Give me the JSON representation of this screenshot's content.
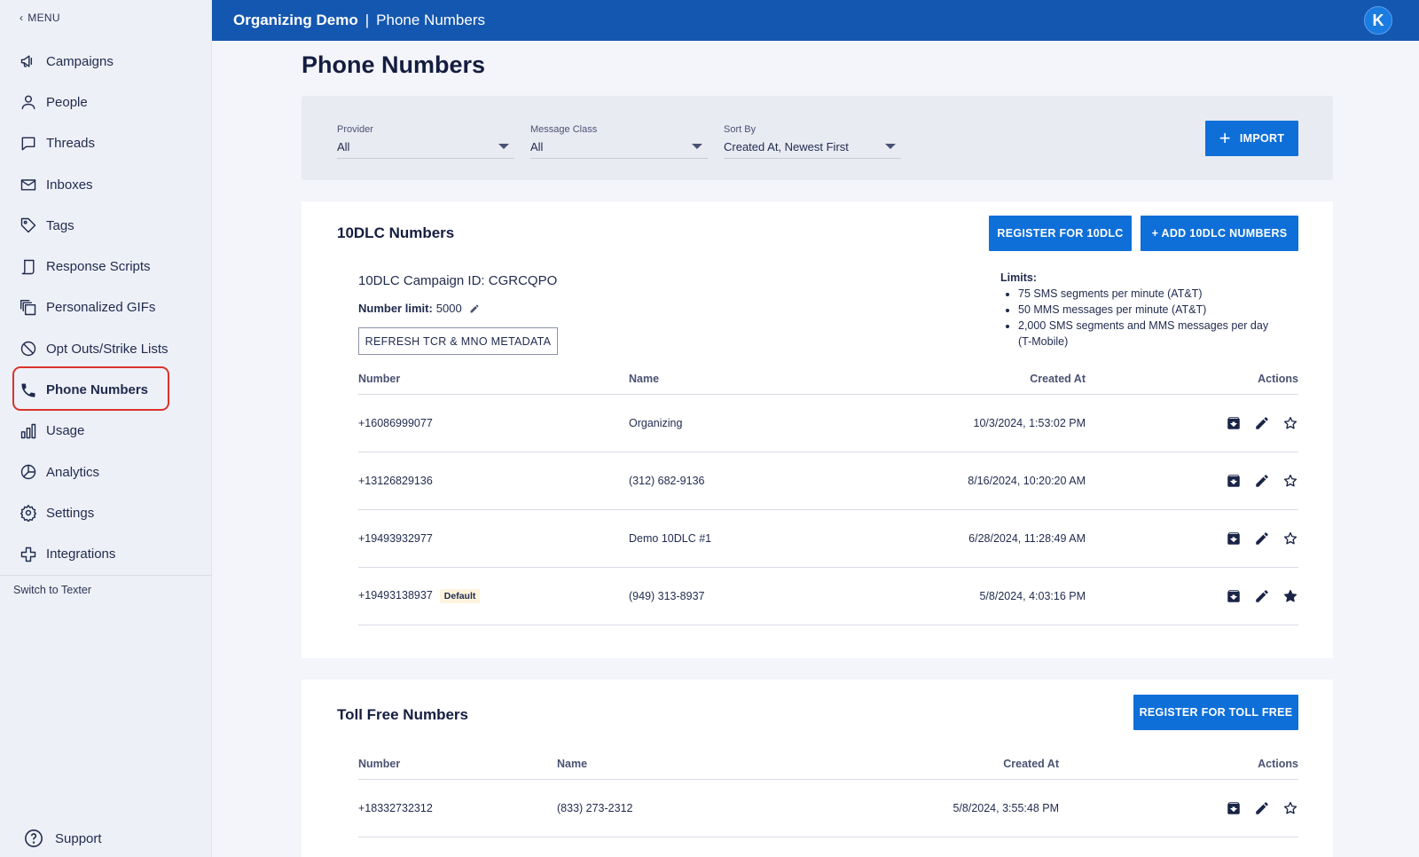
{
  "sidebar": {
    "menu_label": "MENU",
    "items": [
      {
        "label": "Campaigns",
        "icon": "megaphone-icon"
      },
      {
        "label": "People",
        "icon": "person-icon"
      },
      {
        "label": "Threads",
        "icon": "chat-bubble-icon"
      },
      {
        "label": "Inboxes",
        "icon": "envelope-icon"
      },
      {
        "label": "Tags",
        "icon": "tag-icon"
      },
      {
        "label": "Response Scripts",
        "icon": "script-icon"
      },
      {
        "label": "Personalized GIFs",
        "icon": "gif-stack-icon"
      },
      {
        "label": "Opt Outs/Strike Lists",
        "icon": "block-icon"
      },
      {
        "label": "Phone Numbers",
        "icon": "phone-icon"
      },
      {
        "label": "Usage",
        "icon": "bar-chart-icon"
      },
      {
        "label": "Analytics",
        "icon": "pie-chart-icon"
      },
      {
        "label": "Settings",
        "icon": "gear-icon"
      },
      {
        "label": "Integrations",
        "icon": "puzzle-icon"
      }
    ],
    "active_item": "Phone Numbers",
    "switch_label": "Switch to Texter",
    "support_label": "Support"
  },
  "topbar": {
    "org": "Organizing Demo",
    "separator": "|",
    "page": "Phone Numbers",
    "avatar_letter": "K"
  },
  "page_title": "Phone Numbers",
  "filters": {
    "provider": {
      "label": "Provider",
      "value": "All"
    },
    "message_class": {
      "label": "Message Class",
      "value": "All"
    },
    "sort_by": {
      "label": "Sort By",
      "value": "Created At, Newest First"
    },
    "import_label": "IMPORT"
  },
  "tendlc": {
    "title": "10DLC Numbers",
    "register_label": "REGISTER FOR 10DLC",
    "add_label": "+ ADD 10DLC NUMBERS",
    "campaign_id": "10DLC Campaign ID: CGRCQPO",
    "number_limit_label": "Number limit:",
    "number_limit_value": "5000",
    "refresh_label": "REFRESH TCR & MNO METADATA",
    "limits_title": "Limits:",
    "limits": [
      "75 SMS segments per minute (AT&T)",
      "50 MMS messages per minute (AT&T)",
      "2,000 SMS segments and MMS messages per day (T-Mobile)"
    ],
    "columns": {
      "number": "Number",
      "name": "Name",
      "created": "Created At",
      "actions": "Actions"
    },
    "rows": [
      {
        "number": "+16086999077",
        "badge": "",
        "name": "Organizing",
        "created": "10/3/2024, 1:53:02 PM",
        "starred": false
      },
      {
        "number": "+13126829136",
        "badge": "",
        "name": "(312) 682-9136",
        "created": "8/16/2024, 10:20:20 AM",
        "starred": false
      },
      {
        "number": "+19493932977",
        "badge": "",
        "name": "Demo 10DLC #1",
        "created": "6/28/2024, 11:28:49 AM",
        "starred": false
      },
      {
        "number": "+19493138937",
        "badge": "Default",
        "name": "(949) 313-8937",
        "created": "5/8/2024, 4:03:16 PM",
        "starred": true
      }
    ]
  },
  "tollfree": {
    "title": "Toll Free Numbers",
    "register_label": "REGISTER FOR TOLL FREE",
    "columns": {
      "number": "Number",
      "name": "Name",
      "created": "Created At",
      "actions": "Actions"
    },
    "rows": [
      {
        "number": "+18332732312",
        "name": "(833) 273-2312",
        "created": "5/8/2024, 3:55:48 PM",
        "starred": false
      }
    ]
  },
  "colors": {
    "topbar": "#1457b0",
    "primary_button": "#0f6fd8",
    "active_highlight": "#d9342b",
    "default_badge_bg": "#fdf3dc"
  }
}
